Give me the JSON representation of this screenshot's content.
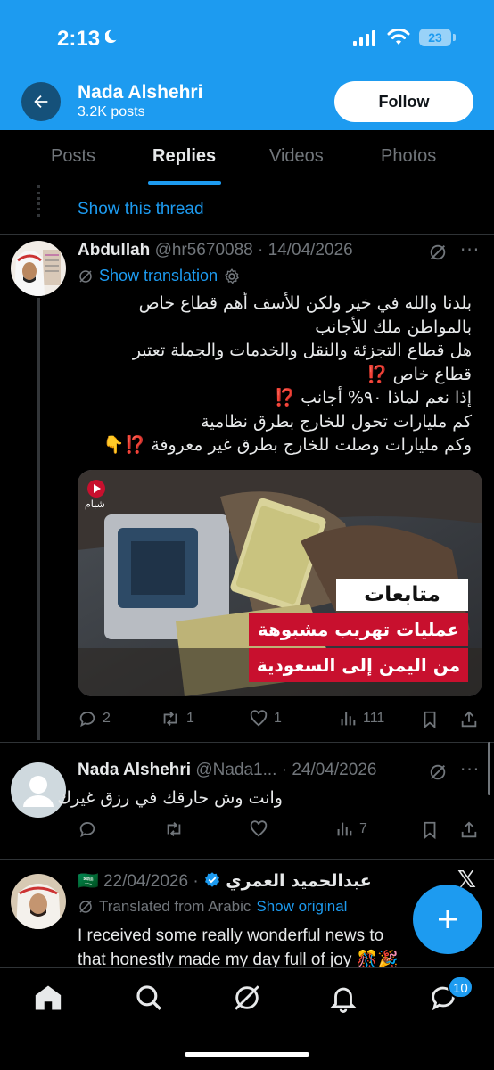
{
  "status_bar": {
    "time": "2:13",
    "battery": "23"
  },
  "header": {
    "name": "Nada Alshehri",
    "posts": "3.2K posts",
    "follow_label": "Follow"
  },
  "tabs": [
    {
      "label": "Posts"
    },
    {
      "label": "Replies"
    },
    {
      "label": "Videos"
    },
    {
      "label": "Photos"
    }
  ],
  "thread": {
    "show_thread": "Show this thread"
  },
  "tweet1": {
    "name": "Abdullah",
    "handle": "@hr5670088",
    "sep": " · ",
    "date": "14/04/2026",
    "show_translation": "Show translation",
    "lines": [
      "بلدنا والله في خير ولكن للأسف أهم قطاع خاص",
      "بالمواطن ملك للأجانب",
      "هل قطاع التجزئة والنقل والخدمات والجملة تعتبر",
      "قطاع خاص ⁉️",
      "إذا نعم لماذا ٩٠% أجانب ⁉️",
      "كم مليارات تحول للخارج بطرق نظامية",
      "وكم مليارات وصلت للخارج بطرق غير معروفة ⁉️👇"
    ],
    "media": {
      "banner_top": "متابعات",
      "banner_line1": "عمليات تهريب مشبوهة",
      "banner_line2": "من اليمن إلى السعودية",
      "logo_text": "شبام"
    },
    "stats": {
      "replies": "2",
      "reposts": "1",
      "likes": "1",
      "views": "111"
    }
  },
  "tweet2": {
    "name": "Nada Alshehri",
    "handle": "@Nada1...",
    "sep": " · ",
    "date": "24/04/2026",
    "text": "وانت وش حارقك في رزق غيرك",
    "stats": {
      "views": "7"
    }
  },
  "tweet3": {
    "flag": "🇸🇦",
    "name": "عبدالحميد العمري",
    "sep": " · ",
    "date": "22/04/2026",
    "translated_from": "Translated from Arabic",
    "show_original": "Show original",
    "lines": [
      "I received some really wonderful news to",
      "that honestly made my day full of joy 🎊🎉"
    ]
  },
  "nav": {
    "messages_badge": "10"
  },
  "colors": {
    "accent": "#1d9bf0",
    "background": "#000000",
    "text": "#e7e9ea",
    "muted": "#71767b"
  }
}
